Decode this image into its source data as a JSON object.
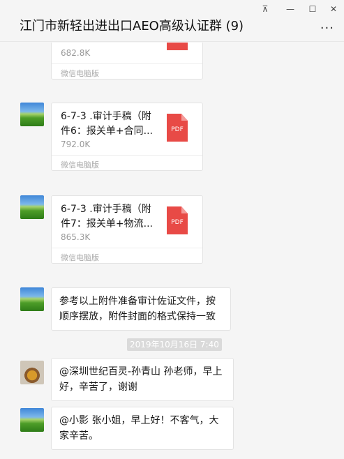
{
  "window": {
    "title": "江门市新轻出进出口AEO高级认证群 (9)",
    "pin_glyph": "⊼",
    "minimize_glyph": "—",
    "maximize_glyph": "☐",
    "close_glyph": "✕",
    "more_glyph": "···"
  },
  "messages": {
    "m0": {
      "size": "682.8K",
      "source": "微信电脑版"
    },
    "m1": {
      "name": "6-7-3 .审计手稿（附件6：报关单+合同...",
      "size": "792.0K",
      "source": "微信电脑版",
      "icon_label": "PDF"
    },
    "m2": {
      "name": "6-7-3 .审计手稿（附件7：报关单+物流...",
      "size": "865.3K",
      "source": "微信电脑版",
      "icon_label": "PDF"
    },
    "m3": {
      "text": "参考以上附件准备审计佐证文件，按顺序摆放，附件封面的格式保持一致"
    },
    "timestamp": "2019年10月16日 7:40",
    "m4": {
      "text": "@深圳世纪百灵-孙青山   孙老师，早上好，辛苦了，谢谢"
    },
    "m5": {
      "text": "@小影 张小姐，早上好！不客气，大家辛苦。"
    }
  }
}
